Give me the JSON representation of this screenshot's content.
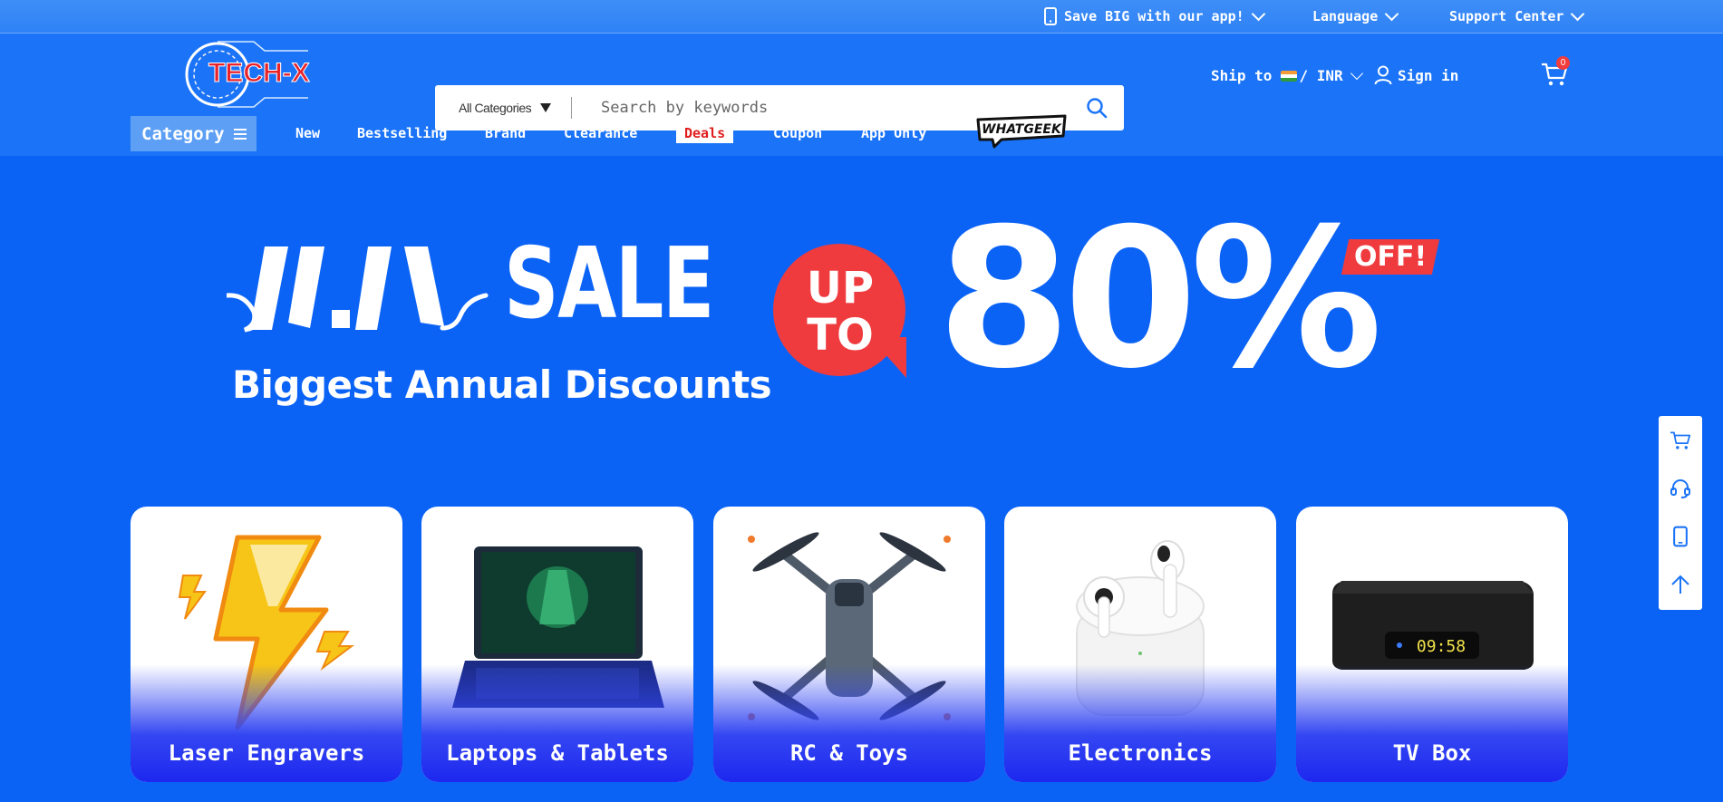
{
  "topbar": {
    "app_promo": "Save BIG with our app!",
    "language": "Language",
    "support": "Support Center"
  },
  "header": {
    "logo_text": "TECH-X",
    "search": {
      "category": "All Categories",
      "placeholder": "Search by keywords"
    },
    "ship_to_label": "Ship to",
    "currency": "/ INR",
    "sign_in": "Sign in",
    "cart_count": "0"
  },
  "nav": {
    "category": "Category",
    "links": [
      "New",
      "Bestselling",
      "Brand",
      "Clearance",
      "Deals",
      "Coupon",
      "App Only"
    ],
    "brand_logo": "WHATGEEK"
  },
  "banner": {
    "sale": "SALE",
    "subtitle": "Biggest Annual Discounts",
    "up_to": [
      "UP",
      "TO"
    ],
    "percent": "80%",
    "off": "OFF!"
  },
  "categories": [
    {
      "label": "Laser Engravers"
    },
    {
      "label": "Laptops & Tablets"
    },
    {
      "label": "RC & Toys"
    },
    {
      "label": "Electronics"
    },
    {
      "label": "TV Box"
    }
  ],
  "tvbox_display": "09:58",
  "colors": {
    "background": "#0b63f6",
    "accent_red": "#ef3b3e",
    "deals_red": "#e01e1e"
  },
  "sidebar_icons": [
    "cart-icon",
    "headset-icon",
    "phone-icon",
    "arrow-up-icon"
  ]
}
